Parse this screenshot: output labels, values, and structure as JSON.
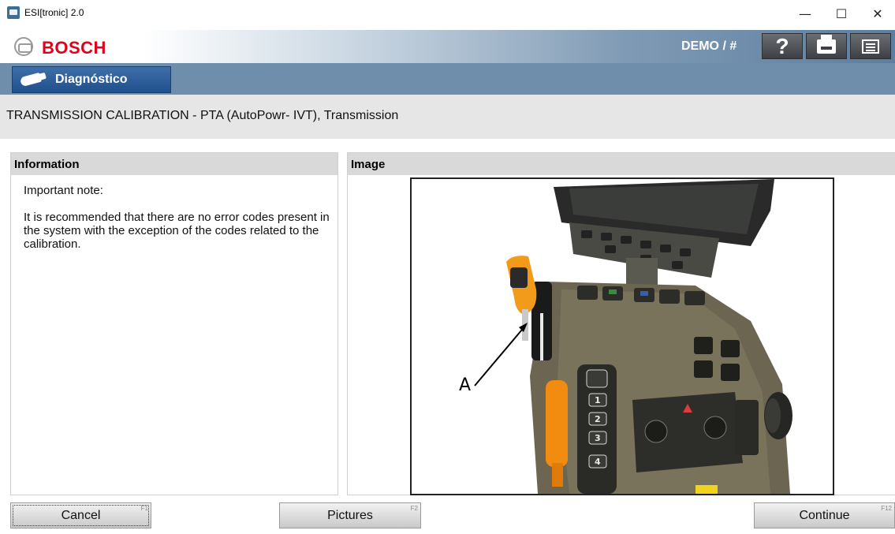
{
  "window": {
    "title": "ESI[tronic] 2.0",
    "minimize_glyph": "—",
    "maximize_glyph": "☐",
    "close_glyph": "✕"
  },
  "brand": {
    "name": "BOSCH",
    "user_label": "DEMO / #",
    "help_glyph": "?",
    "colors": {
      "brand_red": "#e2001a",
      "nav_blue": "#20508d",
      "toolbar_dark": "#3c3f43"
    }
  },
  "nav": {
    "active_tab": "Diagnóstico"
  },
  "section": {
    "title": "TRANSMISSION CALIBRATION - PTA (AutoPowr- IVT), Transmission"
  },
  "information": {
    "header": "Information",
    "note_title": "Important note:",
    "paragraph": "It is recommended that there are no error codes present in the system with the exception of the codes related to the calibration."
  },
  "image_panel": {
    "header": "Image",
    "callout_label": "A"
  },
  "buttons": {
    "cancel": {
      "label": "Cancel",
      "key": "F1"
    },
    "pictures": {
      "label": "Pictures",
      "key": "F2"
    },
    "continue": {
      "label": "Continue",
      "key": "F12"
    }
  }
}
